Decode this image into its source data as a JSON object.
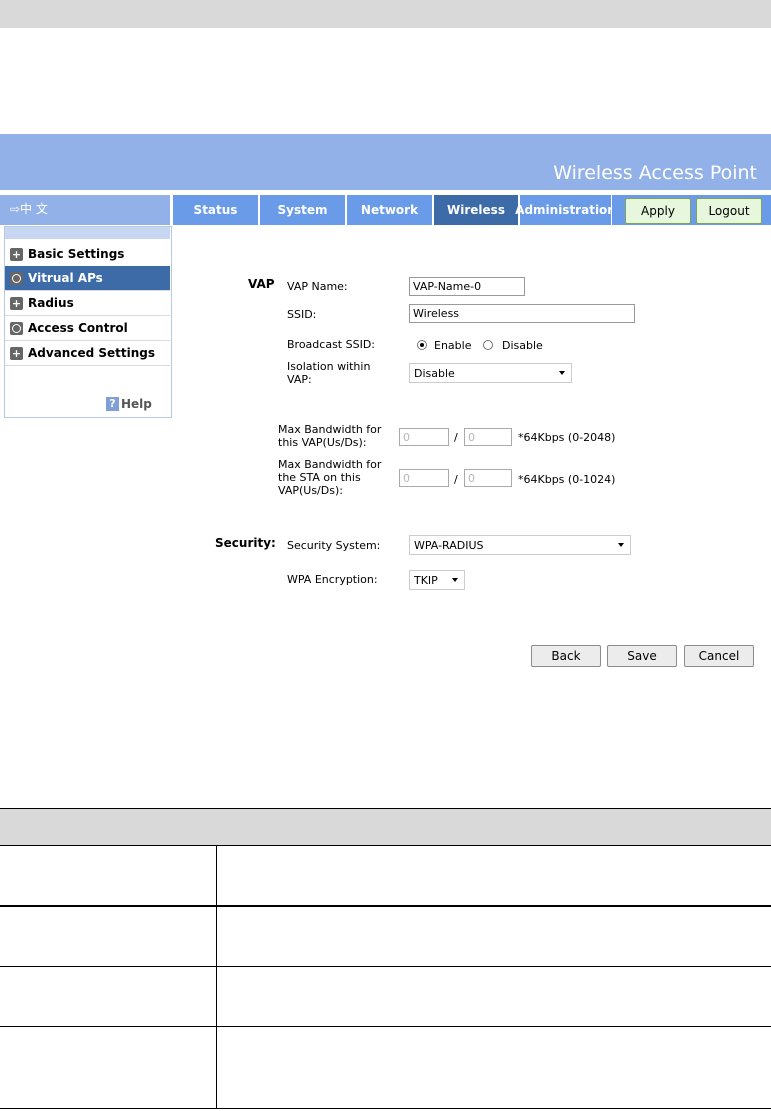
{
  "header": {
    "title": "Wireless Access Point",
    "language_link": "⇨中 文"
  },
  "tabs": [
    {
      "label": "Status"
    },
    {
      "label": "System"
    },
    {
      "label": "Network"
    },
    {
      "label": "Wireless"
    },
    {
      "label": "Administration"
    }
  ],
  "active_tab": "Wireless",
  "header_buttons": {
    "apply": "Apply",
    "logout": "Logout"
  },
  "sidebar": {
    "items": [
      {
        "label": "Basic Settings",
        "icon": "plus-icon"
      },
      {
        "label": "Vitrual APs",
        "icon": "circle-icon"
      },
      {
        "label": "Radius",
        "icon": "plus-icon"
      },
      {
        "label": "Access Control",
        "icon": "circle-icon"
      },
      {
        "label": "Advanced Settings",
        "icon": "plus-icon"
      }
    ],
    "help": "Help"
  },
  "form": {
    "vap_section": "VAP",
    "vap_name_label": "VAP Name:",
    "vap_name_value": "VAP-Name-0",
    "ssid_label": "SSID:",
    "ssid_value": "Wireless",
    "broadcast_label": "Broadcast SSID:",
    "enable_label": "Enable",
    "disable_label": "Disable",
    "isolation_label_1": "Isolation within",
    "isolation_label_2": "VAP:",
    "isolation_value": "Disable",
    "maxbw_vap_label_1": "Max Bandwidth for",
    "maxbw_vap_label_2": "this VAP(Us/Ds):",
    "maxbw_vap_up": "0",
    "maxbw_vap_down": "0",
    "slash": "/",
    "maxbw_vap_unit": "*64Kbps (0-2048)",
    "maxbw_sta_label_1": "Max Bandwidth for",
    "maxbw_sta_label_2": "the STA on this",
    "maxbw_sta_label_3": "VAP(Us/Ds):",
    "maxbw_sta_up": "0",
    "maxbw_sta_down": "0",
    "maxbw_sta_unit": "*64Kbps (0-1024)",
    "security_section": "Security:",
    "security_system_label": "Security System:",
    "security_system_value": "WPA-RADIUS",
    "wpa_enc_label": "WPA Encryption:",
    "wpa_enc_value": "TKIP"
  },
  "buttons": {
    "back": "Back",
    "save": "Save",
    "cancel": "Cancel"
  },
  "colors": {
    "header": "#92b1e9",
    "tab": "#6a9be9",
    "tab_active": "#3c6ba8"
  }
}
